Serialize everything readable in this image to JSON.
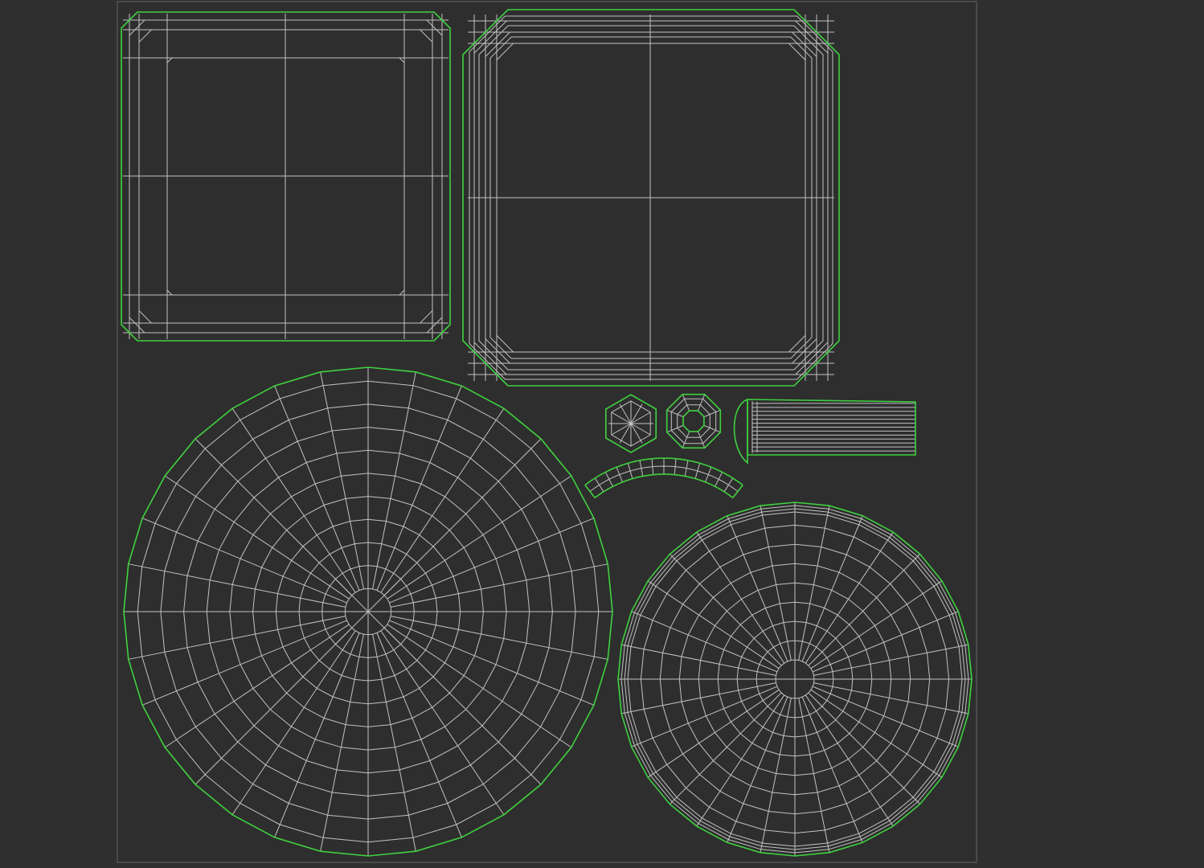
{
  "colors": {
    "background": "#2f2f2f",
    "uv_space_fill": "#2e2e2e",
    "uv_space_border": "#4a4a4a",
    "wire": "#c2c2c2",
    "seam": "#3fd13f"
  },
  "uv_islands": [
    {
      "id": "top-left-square",
      "kind": "rounded-square-grid"
    },
    {
      "id": "top-right-square",
      "kind": "rounded-square-grid-double-border"
    },
    {
      "id": "large-disc",
      "kind": "radial-disc"
    },
    {
      "id": "small-disc",
      "kind": "radial-disc-ringed"
    },
    {
      "id": "hexagon-cap",
      "kind": "radial-hexagon"
    },
    {
      "id": "octagon-ring",
      "kind": "ring-octagon"
    },
    {
      "id": "cylinder-strip",
      "kind": "strip"
    },
    {
      "id": "arc-segment-strip",
      "kind": "arc-strip"
    }
  ]
}
